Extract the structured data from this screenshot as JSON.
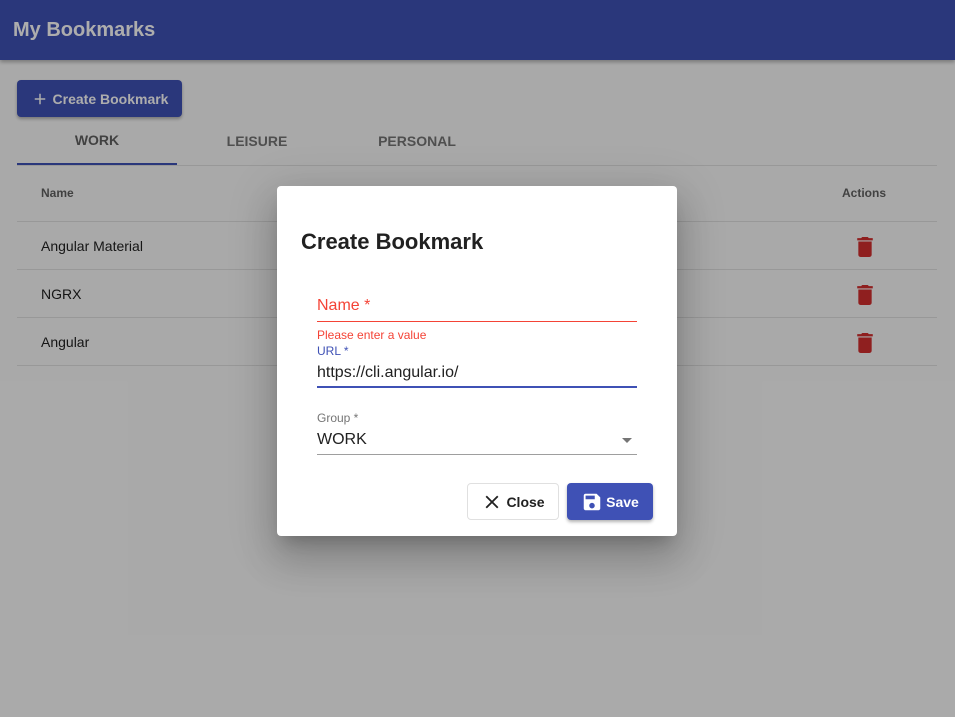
{
  "app": {
    "title": "My Bookmarks"
  },
  "actions": {
    "create_label": "Create Bookmark"
  },
  "tabs": [
    {
      "label": "WORK",
      "active": true
    },
    {
      "label": "LEISURE",
      "active": false
    },
    {
      "label": "PERSONAL",
      "active": false
    }
  ],
  "table": {
    "headers": {
      "name": "Name",
      "actions": "Actions"
    },
    "rows": [
      {
        "name": "Angular Material"
      },
      {
        "name": "NGRX"
      },
      {
        "name": "Angular"
      }
    ]
  },
  "dialog": {
    "title": "Create Bookmark",
    "name_field": {
      "placeholder": "Name *",
      "value": "",
      "error": "Please enter a value"
    },
    "url_field": {
      "label": "URL *",
      "value": "https://cli.angular.io/"
    },
    "group_field": {
      "label": "Group *",
      "value": "WORK"
    },
    "close_label": "Close",
    "save_label": "Save"
  },
  "colors": {
    "primary": "#3f51b5",
    "error": "#f44336",
    "delete_icon": "#d32f2f"
  },
  "icons": {
    "create": "plus-icon",
    "delete": "trash-icon",
    "close": "close-icon",
    "save": "save-icon",
    "dropdown": "dropdown-arrow-icon"
  }
}
